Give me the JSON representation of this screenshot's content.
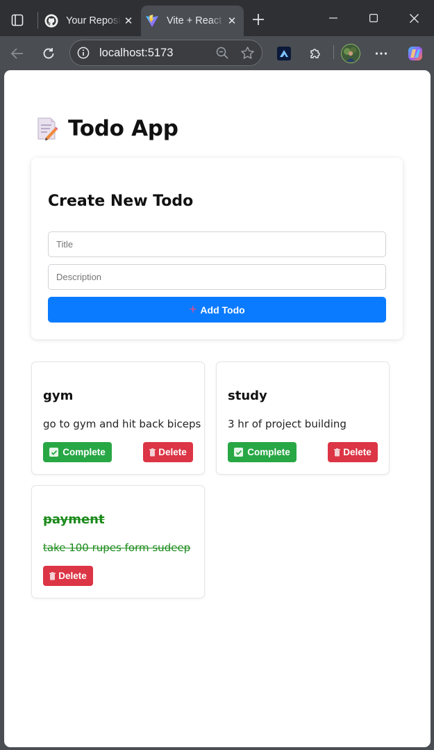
{
  "browser": {
    "tabs": [
      {
        "label": "Your Repositories",
        "favicon": "github-icon",
        "active": false
      },
      {
        "label": "Vite + React",
        "favicon": "vite-icon",
        "active": true
      }
    ],
    "address": "localhost:5173"
  },
  "app": {
    "title": "Todo App",
    "title_icon": "memo-icon"
  },
  "form": {
    "heading": "Create New Todo",
    "title_placeholder": "Title",
    "description_placeholder": "Description",
    "add_button_symbol": "+",
    "add_button_label": "Add Todo"
  },
  "todos": [
    {
      "title": "gym",
      "description": "go to gym and hit back biceps",
      "completed": false,
      "complete_label": "Complete",
      "delete_label": "Delete"
    },
    {
      "title": "study",
      "description": "3 hr of project building",
      "completed": false,
      "complete_label": "Complete",
      "delete_label": "Delete"
    },
    {
      "title": "payment",
      "description": "take 100 rupes form sudeep",
      "completed": true,
      "delete_label": "Delete"
    }
  ],
  "colors": {
    "primary": "#0a7bff",
    "success": "#28a745",
    "danger": "#dc3545",
    "completed_text": "#1a8a1a"
  }
}
